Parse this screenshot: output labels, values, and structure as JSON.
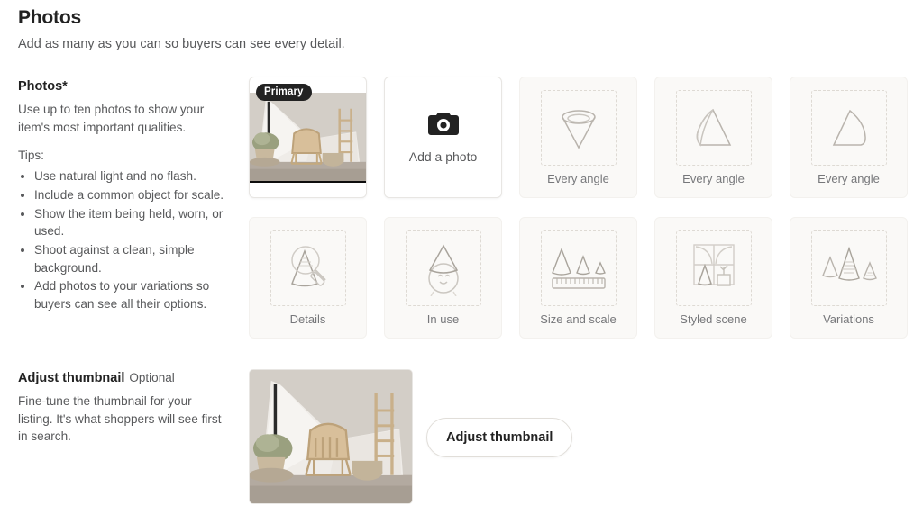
{
  "header": {
    "title": "Photos",
    "subtitle": "Add as many as you can so buyers can see every detail."
  },
  "photos_section": {
    "label": "Photos",
    "required_marker": "*",
    "description": "Use up to ten photos to show your item's most important qualities.",
    "tips_heading": "Tips:",
    "tips": [
      "Use natural light and no flash.",
      "Include a common object for scale.",
      "Show the item being held, worn, or used.",
      "Shoot against a clean, simple background.",
      "Add photos to your variations so buyers can see all their options."
    ],
    "primary_badge": "Primary",
    "add_photo_label": "Add a photo",
    "add_photo_icon": "camera-icon",
    "placeholders": [
      {
        "label": "Every angle",
        "icon": "cone-top-view-icon"
      },
      {
        "label": "Every angle",
        "icon": "cone-angled-view-icon"
      },
      {
        "label": "Every angle",
        "icon": "cone-side-view-icon"
      },
      {
        "label": "Details",
        "icon": "magnifier-cone-icon"
      },
      {
        "label": "In use",
        "icon": "face-party-hat-icon"
      },
      {
        "label": "Size and scale",
        "icon": "cones-ruler-icon"
      },
      {
        "label": "Styled scene",
        "icon": "window-cone-plant-icon"
      },
      {
        "label": "Variations",
        "icon": "three-cones-icon"
      }
    ]
  },
  "thumbnail_section": {
    "label": "Adjust thumbnail",
    "optional_marker": "Optional",
    "description": "Fine-tune the thumbnail for your listing. It's what shoppers will see first in search.",
    "button_label": "Adjust thumbnail"
  },
  "colors": {
    "text_primary": "#222222",
    "text_secondary": "#58595b",
    "tile_placeholder_bg": "#faf9f7",
    "dashed_border": "#dedad4",
    "badge_bg": "#222222"
  }
}
